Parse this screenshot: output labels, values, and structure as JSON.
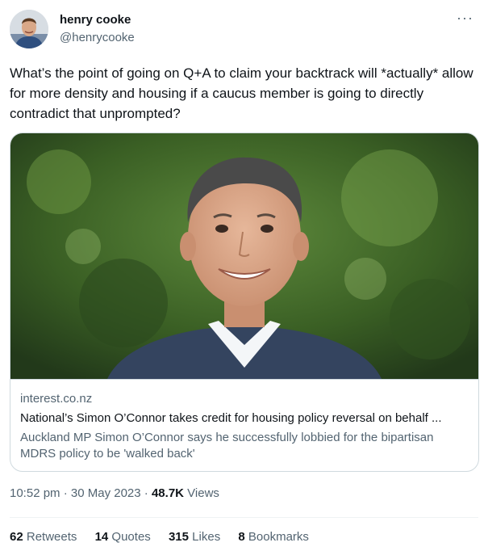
{
  "author": {
    "name": "henry cooke",
    "handle": "@henrycooke",
    "avatar_icon": "profile-photo"
  },
  "more_icon": "ellipsis-icon",
  "tweet": {
    "text": "What’s the point of going on Q+A to claim your backtrack will *actually* allow for more density and housing if a caucus member is going to directly contradict that unprompted?"
  },
  "card": {
    "image_icon": "portrait-photo",
    "domain": "interest.co.nz",
    "title": "National’s Simon O’Connor takes credit for housing policy reversal on behalf ...",
    "description": "Auckland MP Simon O’Connor says he successfully lobbied for the bipartisan MDRS policy to be 'walked back'"
  },
  "meta": {
    "time": "10:52 pm",
    "separator": "·",
    "date": "30 May 2023",
    "views_count": "48.7K",
    "views_label": "Views"
  },
  "stats": {
    "retweets_count": "62",
    "retweets_label": "Retweets",
    "quotes_count": "14",
    "quotes_label": "Quotes",
    "likes_count": "315",
    "likes_label": "Likes",
    "bookmarks_count": "8",
    "bookmarks_label": "Bookmarks"
  },
  "colors": {
    "text": "#0f1419",
    "secondary": "#536471",
    "border": "#cfd9de",
    "suit": "#3b4a66",
    "foliage": "#3f6b2a"
  }
}
